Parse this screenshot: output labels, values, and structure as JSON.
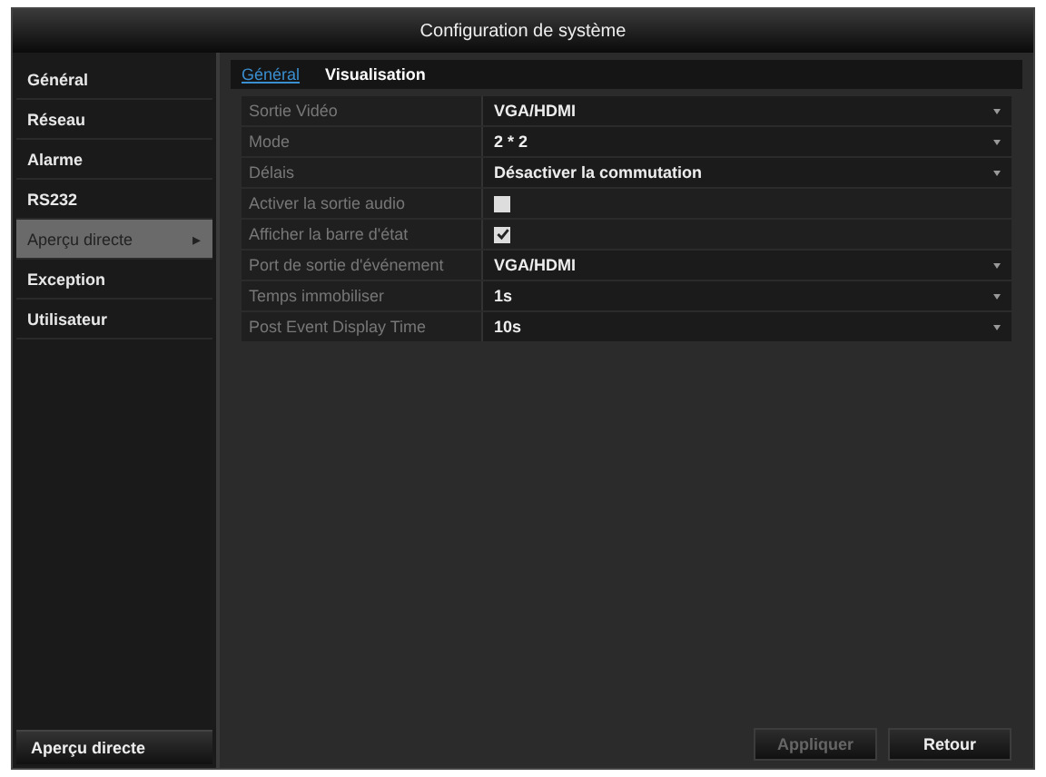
{
  "window": {
    "title": "Configuration de système"
  },
  "sidebar": {
    "items": [
      {
        "label": "Général",
        "selected": false
      },
      {
        "label": "Réseau",
        "selected": false
      },
      {
        "label": "Alarme",
        "selected": false
      },
      {
        "label": "RS232",
        "selected": false
      },
      {
        "label": "Aperçu directe",
        "selected": true,
        "arrow": "▸"
      },
      {
        "label": "Exception",
        "selected": false
      },
      {
        "label": "Utilisateur",
        "selected": false
      }
    ],
    "bottom_item": "Aperçu directe"
  },
  "tabs": [
    {
      "label": "Général",
      "selected": true
    },
    {
      "label": "Visualisation",
      "selected": false
    }
  ],
  "settings": [
    {
      "kind": "select",
      "label": "Sortie Vidéo",
      "value": "VGA/HDMI"
    },
    {
      "kind": "select",
      "label": "Mode",
      "value": "2 * 2"
    },
    {
      "kind": "select",
      "label": "Délais",
      "value": "Désactiver la commutation"
    },
    {
      "kind": "checkbox",
      "label": "Activer la sortie audio",
      "checked": false
    },
    {
      "kind": "checkbox",
      "label": "Afficher la barre d'état",
      "checked": true
    },
    {
      "kind": "select",
      "label": "Port de sortie d'événement",
      "value": "VGA/HDMI"
    },
    {
      "kind": "select",
      "label": "Temps immobiliser",
      "value": "1s"
    },
    {
      "kind": "select",
      "label": "Post Event Display Time",
      "value": "10s"
    }
  ],
  "buttons": [
    {
      "label": "Appliquer",
      "disabled": true
    },
    {
      "label": "Retour",
      "disabled": false
    }
  ]
}
